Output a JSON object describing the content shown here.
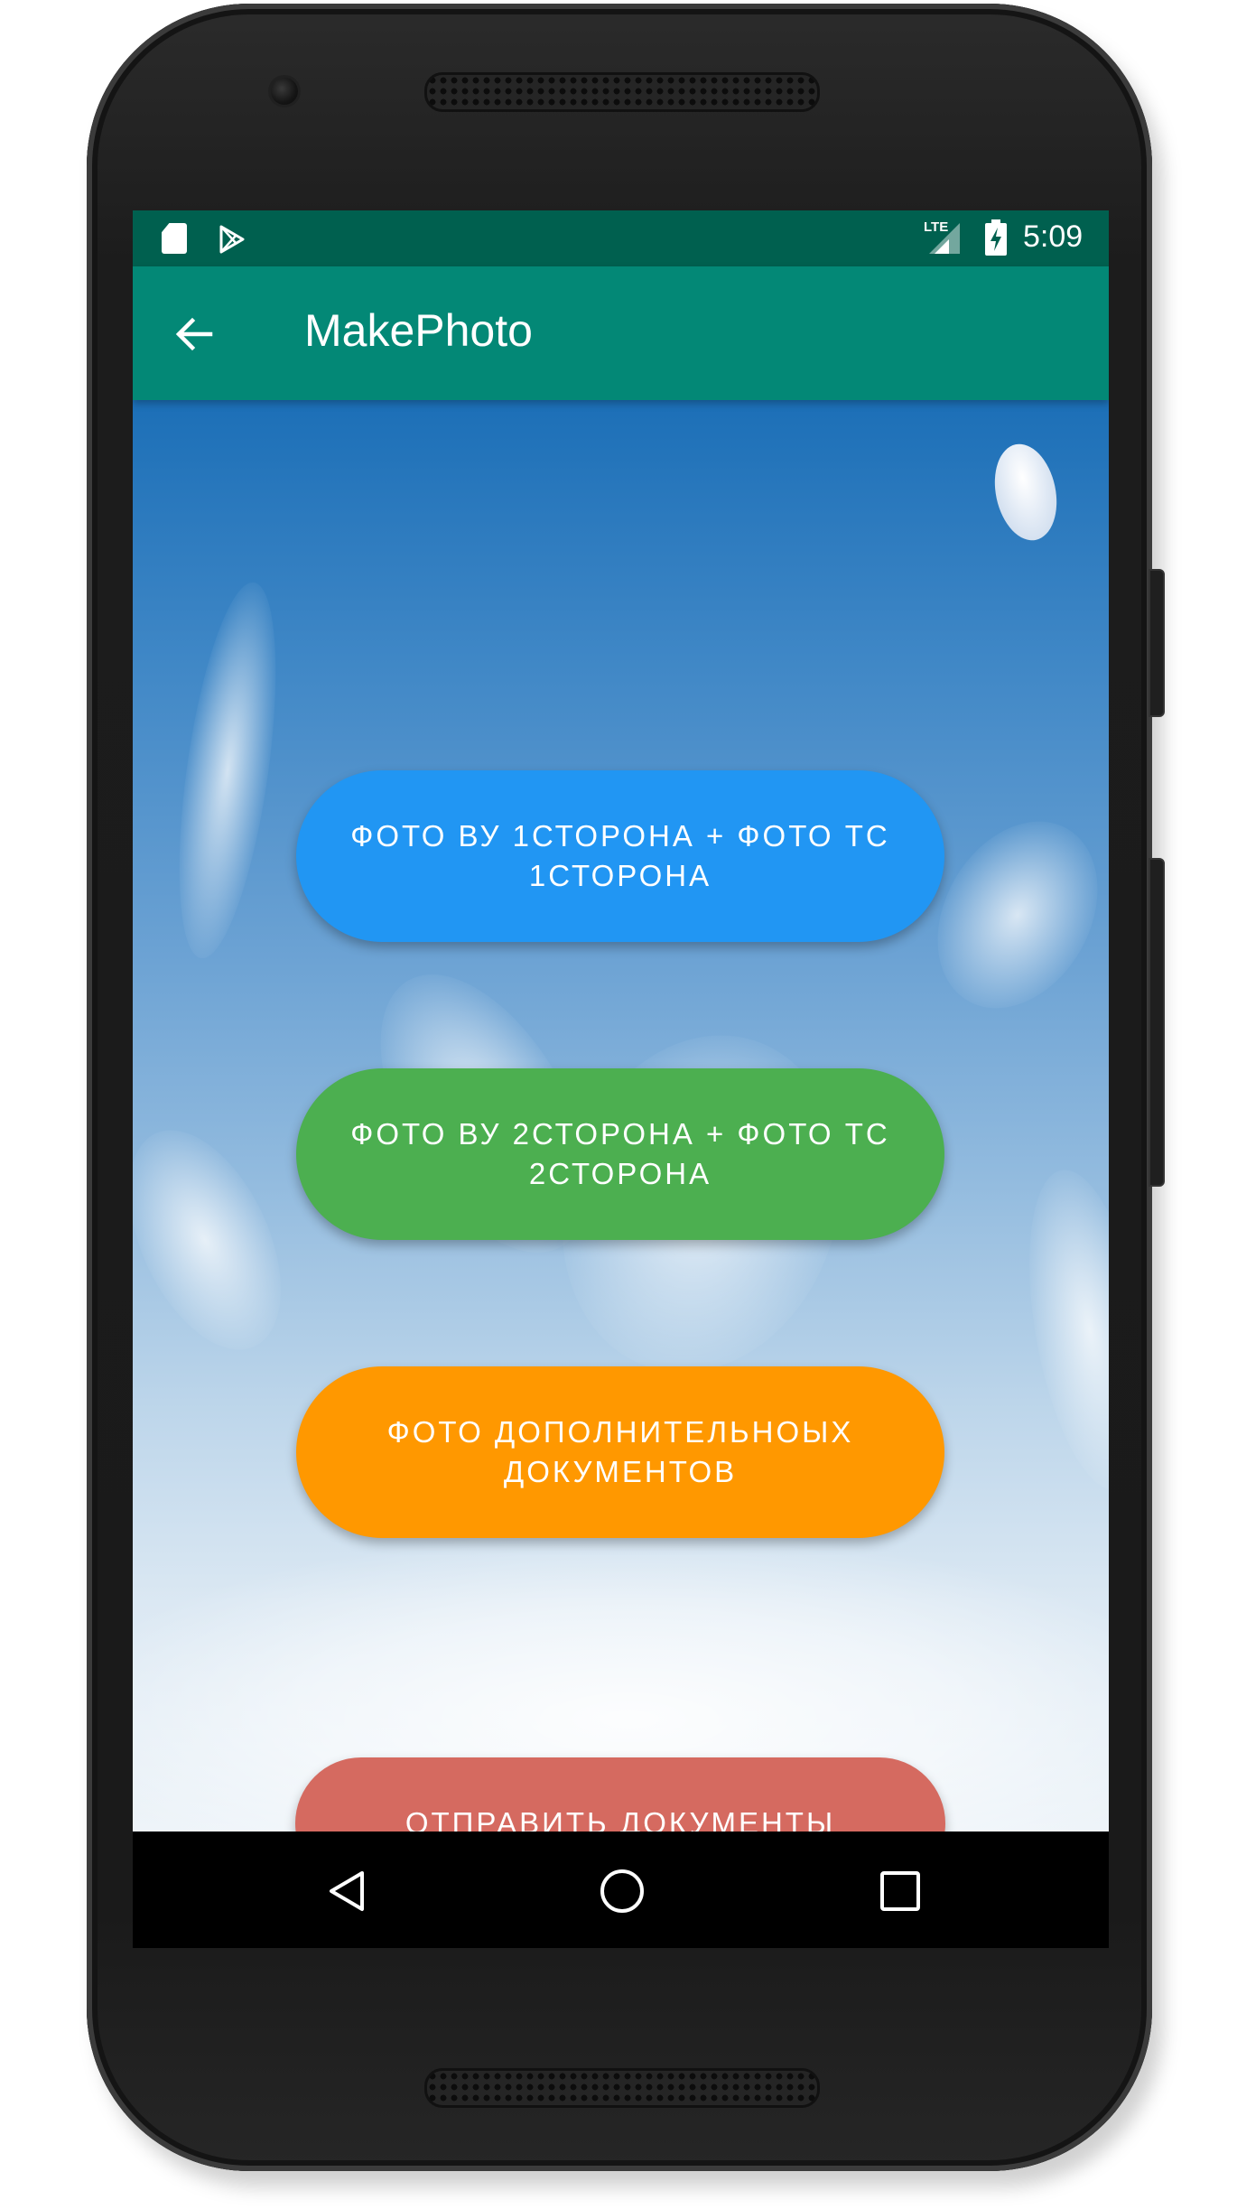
{
  "status_bar": {
    "time": "5:09",
    "network": "LTE",
    "icons": [
      "sd-card-icon",
      "play-store-icon",
      "signal-icon",
      "battery-charging-icon"
    ]
  },
  "app_bar": {
    "title": "MakePhoto",
    "back_icon": "arrow-back-icon"
  },
  "buttons": [
    {
      "label": "ФОТО ВУ 1СТОРОНА + ФОТО ТС 1СТОРОНА",
      "color": "#2196f3"
    },
    {
      "label": "ФОТО ВУ 2СТОРОНА + ФОТО ТС 2СТОРОНА",
      "color": "#4caf50"
    },
    {
      "label": "ФОТО ДОПОЛНИТЕЛЬНОЫХ ДОКУМЕНТОВ",
      "color": "#ff9800"
    },
    {
      "label": "ОТПРАВИТЬ ДОКУМЕНТЫ",
      "color": "#d56a60"
    }
  ],
  "nav_bar": {
    "icons": [
      "nav-back-icon",
      "nav-home-icon",
      "nav-recents-icon"
    ]
  },
  "colors": {
    "status_bar": "#00604f",
    "app_bar": "#038876"
  }
}
